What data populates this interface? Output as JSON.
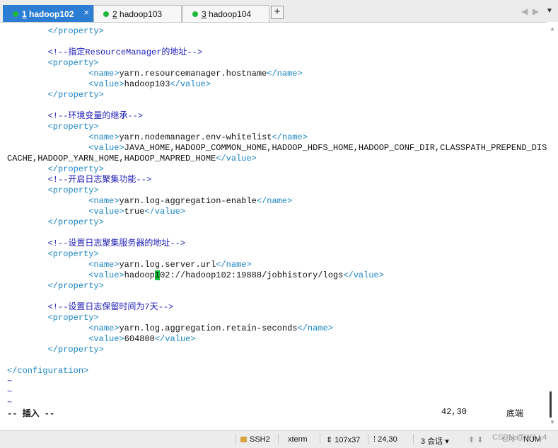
{
  "tabs": [
    {
      "index": "1",
      "label": "hadoop102",
      "active": true
    },
    {
      "index": "2",
      "label": "hadoop103",
      "active": false
    },
    {
      "index": "3",
      "label": "hadoop104",
      "active": false
    }
  ],
  "tab_close_glyph": "×",
  "tab_add_glyph": "+",
  "terminal": {
    "l01": "        </property>",
    "l03": "        <!--指定ResourceManager的地址-->",
    "l04": "        <property>",
    "l05a": "                <name>",
    "l05b": "yarn.resourcemanager.hostname",
    "l05c": "</name>",
    "l06a": "                <value>",
    "l06b": "hadoop103",
    "l06c": "</value>",
    "l07": "        </property>",
    "l09": "        <!--环境变量的继承-->",
    "l10": "        <property>",
    "l11a": "                <name>",
    "l11b": "yarn.nodemanager.env-whitelist",
    "l11c": "</name>",
    "l12a": "                <value>",
    "l12b": "JAVA_HOME,HADOOP_COMMON_HOME,HADOOP_HDFS_HOME,HADOOP_CONF_DIR,CLASSPATH_PREPEND_DIST",
    "l13a": "CACHE,HADOOP_YARN_HOME,HADOOP_MAPRED_HOME",
    "l13b": "</value>",
    "l14": "        </property>",
    "l15": "        <!--开启日志聚集功能-->",
    "l16": "        <property>",
    "l17a": "                <name>",
    "l17b": "yarn.log-aggregation-enable",
    "l17c": "</name>",
    "l18a": "                <value>",
    "l18b": "true",
    "l18c": "</value>",
    "l19": "        </property>",
    "l21": "        <!--设置日志聚集服务器的地址-->",
    "l22": "        <property>",
    "l23a": "                <name>",
    "l23b": "yarn.log.server.url",
    "l23c": "</name>",
    "l24a": "                <value>",
    "l24b": "hadoop",
    "l24cursor": "1",
    "l24c": "02://hadoop102:19888/jobhistory/logs",
    "l24d": "</value>",
    "l25": "        </property>",
    "l27": "        <!--设置日志保留时间为7天-->",
    "l28": "        <property>",
    "l29a": "                <name>",
    "l29b": "yarn.log.aggregation.retain-seconds",
    "l29c": "</name>",
    "l30a": "                <value>",
    "l30b": "604800",
    "l30c": "</value>",
    "l31": "        </property>",
    "l33": "</configuration>",
    "tilde": "~"
  },
  "vim_status": {
    "mode": "-- 插入 --",
    "position": "42,30",
    "scroll": "底端"
  },
  "statusbar": {
    "protocol": "SSH2",
    "term_type": "xterm",
    "size": "107x37",
    "cursor": "24,30",
    "sessions": "3 会话",
    "caps": "CAP",
    "num": "NUM"
  },
  "watermark": "CSDN @WILL4"
}
